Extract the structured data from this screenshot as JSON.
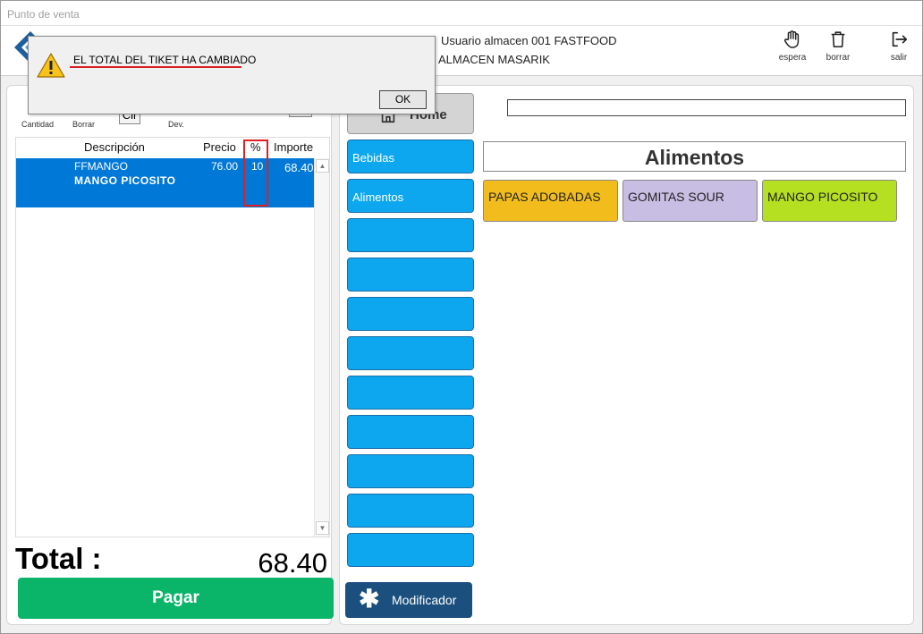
{
  "window": {
    "title": "Punto de venta"
  },
  "header": {
    "user": "Usuario almacen 001 FASTFOOD",
    "store": "ALMACEN MASARIK",
    "buttons": [
      {
        "label": "espera",
        "icon": "hand-icon"
      },
      {
        "label": "borrar",
        "icon": "trash-icon"
      },
      {
        "label": "salir",
        "icon": "logout-icon"
      }
    ]
  },
  "toolbar": {
    "cantidad_label": "Cantidad",
    "borrar_label": "Borrar",
    "dev_label": "Dev.",
    "clear_button": "Clr"
  },
  "ticket": {
    "columns": [
      "Descripción",
      "Precio",
      "%",
      "Importe"
    ],
    "rows": [
      {
        "code": "FFMANGO",
        "name": "MANGO PICOSITO",
        "precio": "76.00",
        "descuento": "10",
        "importe": "68.40"
      }
    ]
  },
  "total": {
    "label": "Total :",
    "value": "68.40"
  },
  "pay_button": "Pagar",
  "home_button": "Home",
  "categories": [
    "Bebidas",
    "Alimentos",
    "",
    "",
    "",
    "",
    "",
    "",
    "",
    "",
    ""
  ],
  "modifier_button": "Modificador",
  "group_title": "Alimentos",
  "products": [
    {
      "name": "PAPAS ADOBADAS",
      "color": "#f2bd1c"
    },
    {
      "name": "GOMITAS SOUR",
      "color": "#c8bde3"
    },
    {
      "name": "MANGO PICOSITO",
      "color": "#b4e021"
    }
  ],
  "dialog": {
    "message": "EL TOTAL DEL TIKET HA CAMBIADO",
    "ok": "OK"
  }
}
